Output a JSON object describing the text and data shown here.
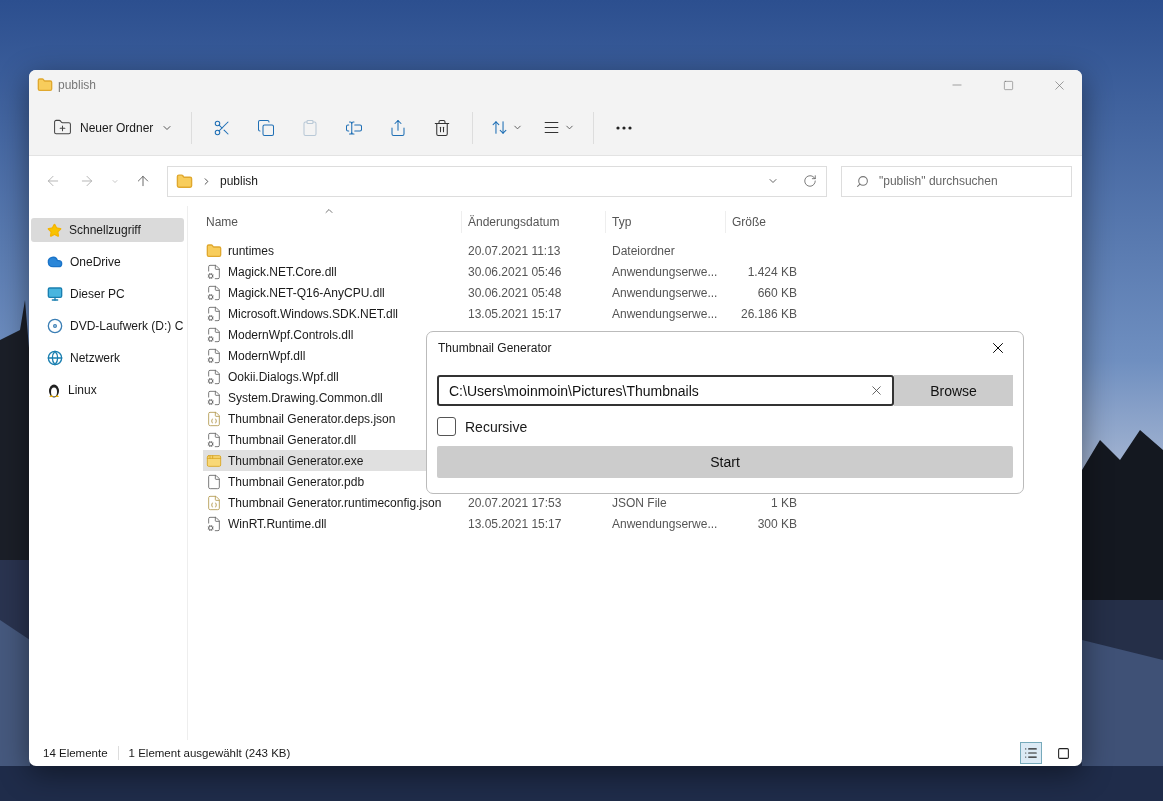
{
  "window": {
    "title": "publish"
  },
  "toolbar": {
    "new_button": {
      "label": "Neuer Ordner"
    },
    "actions": [
      {
        "kind": "cut",
        "disabled": false
      },
      {
        "kind": "copy",
        "disabled": false
      },
      {
        "kind": "paste",
        "disabled": true
      },
      {
        "kind": "rename",
        "disabled": false
      },
      {
        "kind": "share",
        "disabled": false
      },
      {
        "kind": "delete",
        "disabled": false
      }
    ],
    "view_actions": [
      {
        "kind": "sort"
      },
      {
        "kind": "view"
      }
    ]
  },
  "address": {
    "crumb": "publish"
  },
  "search": {
    "placeholder": "\"publish\" durchsuchen"
  },
  "sidebar": {
    "items": [
      {
        "label": "Schnellzugriff",
        "kind": "star",
        "selected": true
      },
      {
        "label": "OneDrive",
        "kind": "cloud",
        "selected": false
      },
      {
        "label": "Dieser PC",
        "kind": "pc",
        "selected": false
      },
      {
        "label": "DVD-Laufwerk (D:) C",
        "kind": "dvd",
        "selected": false
      },
      {
        "label": "Netzwerk",
        "kind": "network",
        "selected": false
      },
      {
        "label": "Linux",
        "kind": "linux",
        "selected": false
      }
    ]
  },
  "table": {
    "columns": [
      "Name",
      "Änderungsdatum",
      "Typ",
      "Größe"
    ],
    "rows": [
      {
        "name": "runtimes",
        "kind": "folder",
        "date": "20.07.2021 11:13",
        "type": "Dateiordner",
        "selected": false
      },
      {
        "name": "Magick.NET.Core.dll",
        "kind": "dll",
        "date": "30.06.2021 05:46",
        "type": "Anwendungserwe...",
        "size": "1.424 KB",
        "selected": false
      },
      {
        "name": "Magick.NET-Q16-AnyCPU.dll",
        "kind": "dll",
        "date": "30.06.2021 05:48",
        "type": "Anwendungserwe...",
        "size": "660 KB",
        "selected": false
      },
      {
        "name": "Microsoft.Windows.SDK.NET.dll",
        "kind": "dll",
        "date": "13.05.2021 15:17",
        "type": "Anwendungserwe...",
        "size": "26.186 KB",
        "selected": false
      },
      {
        "name": "ModernWpf.Controls.dll",
        "kind": "dll",
        "selected": false
      },
      {
        "name": "ModernWpf.dll",
        "kind": "dll",
        "selected": false
      },
      {
        "name": "Ookii.Dialogs.Wpf.dll",
        "kind": "dll",
        "selected": false
      },
      {
        "name": "System.Drawing.Common.dll",
        "kind": "dll",
        "selected": false
      },
      {
        "name": "Thumbnail Generator.deps.json",
        "kind": "json",
        "selected": false
      },
      {
        "name": "Thumbnail Generator.dll",
        "kind": "dll",
        "selected": false
      },
      {
        "name": "Thumbnail Generator.exe",
        "kind": "exe",
        "selected": true
      },
      {
        "name": "Thumbnail Generator.pdb",
        "kind": "file",
        "selected": false
      },
      {
        "name": "Thumbnail Generator.runtimeconfig.json",
        "kind": "json",
        "date": "20.07.2021 17:53",
        "type": "JSON File",
        "size": "1 KB",
        "selected": false
      },
      {
        "name": "WinRT.Runtime.dll",
        "kind": "dll",
        "date": "13.05.2021 15:17",
        "type": "Anwendungserwe...",
        "size": "300 KB",
        "selected": false
      }
    ]
  },
  "status_bar": {
    "count": "14 Elemente",
    "selection": "1 Element ausgewählt (243 KB)",
    "views": [
      {
        "kind": "details",
        "selected": true
      },
      {
        "kind": "tiles",
        "selected": false
      }
    ]
  },
  "dialog": {
    "title": "Thumbnail Generator",
    "path_field": {
      "value": "C:\\Users\\moinmoin\\Pictures\\Thumbnails"
    },
    "browse_button": "Browse",
    "recursive": {
      "label": "Recursive",
      "checked": false
    },
    "start_button": "Start"
  }
}
